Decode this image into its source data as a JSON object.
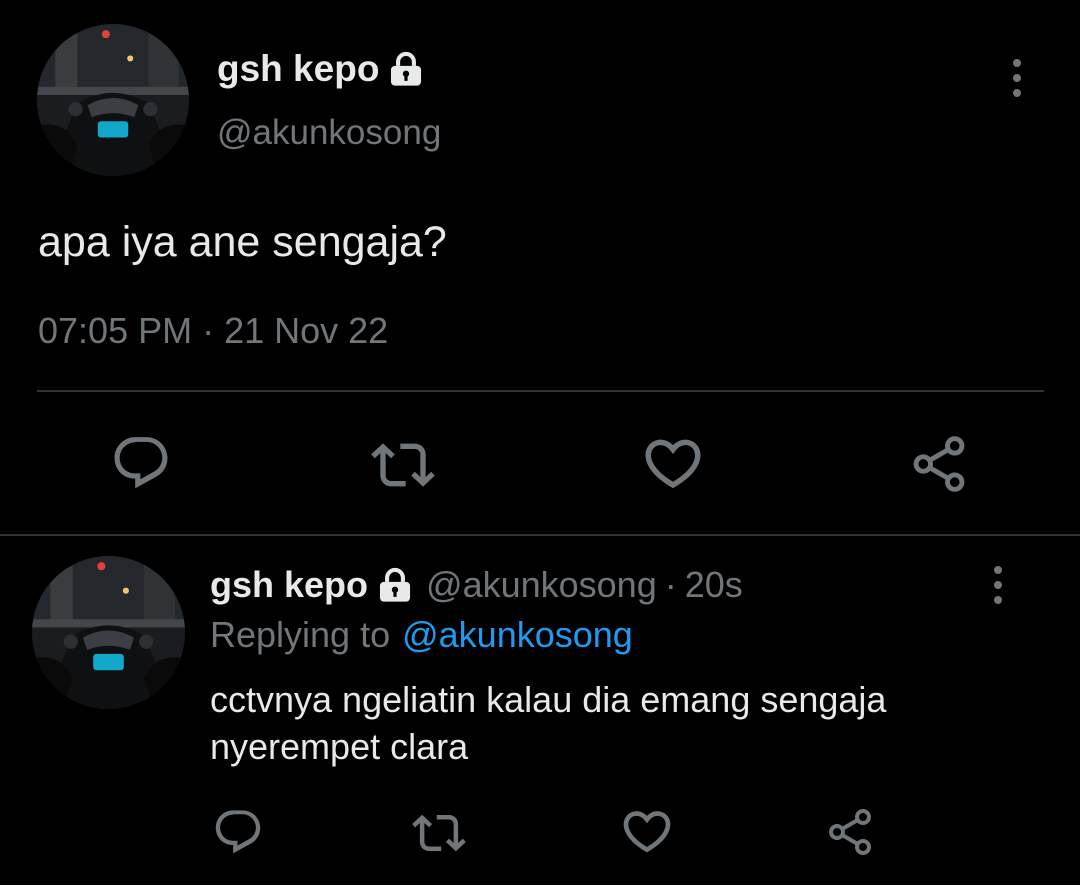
{
  "main_tweet": {
    "display_name": "gsh kepo",
    "handle": "@akunkosong",
    "text": "apa iya ane sengaja?",
    "timestamp": "07:05 PM · 21 Nov 22",
    "icons": [
      "lock-icon",
      "more-options-icon",
      "reply-icon",
      "retweet-icon",
      "like-icon",
      "share-icon"
    ]
  },
  "reply_tweet": {
    "display_name": "gsh kepo",
    "handle": "@akunkosong",
    "time_ago": "20s",
    "replying_prefix": "Replying to",
    "replying_handle": "@akunkosong",
    "text_line1": "cctvnya ngeliatin kalau dia emang sengaja",
    "text_line2": "nyerempet clara",
    "icons": [
      "lock-icon",
      "more-options-icon",
      "reply-icon",
      "retweet-icon",
      "like-icon",
      "share-icon"
    ]
  },
  "colors": {
    "background": "#000000",
    "text": "#e7e9ea",
    "muted": "#71767b",
    "link": "#1d9bf0",
    "divider": "#2f3336"
  }
}
